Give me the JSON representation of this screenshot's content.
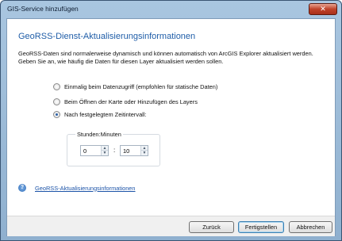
{
  "window": {
    "title": "GIS-Service hinzufügen",
    "close_symbol": "✕"
  },
  "content": {
    "heading": "GeoRSS-Dienst-Aktualisierungsinformationen",
    "intro": "GeoRSS-Daten sind normalerweise dynamisch und können automatisch von ArcGIS Explorer aktualisiert werden. Geben Sie an, wie häufig die Daten für diesen Layer aktualisiert werden sollen."
  },
  "options": [
    {
      "label": "Einmalig beim Datenzugriff (empfohlen für statische Daten)",
      "checked": false
    },
    {
      "label": "Beim Öffnen der Karte oder Hinzufügen des Layers",
      "checked": false
    },
    {
      "label": "Nach festgelegtem Zeitintervall:",
      "checked": true
    }
  ],
  "interval": {
    "group_label": "Stunden:Minuten",
    "hours": "0",
    "separator": ":",
    "minutes": "10"
  },
  "help": {
    "icon": "help-icon",
    "link_text": "GeoRSS-Aktualisierungsinformationen"
  },
  "buttons": {
    "back": "Zurück",
    "finish": "Fertigstellen",
    "cancel": "Abbrechen"
  },
  "colors": {
    "heading": "#1f5da8",
    "link": "#1d54a8",
    "close_button": "#c0432a"
  }
}
